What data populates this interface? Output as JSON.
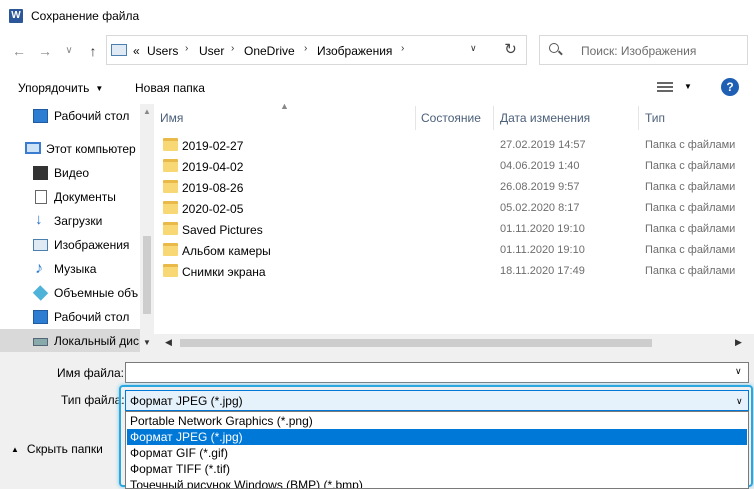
{
  "window": {
    "title": "Сохранение файла",
    "app_icon": "W"
  },
  "nav": {
    "back": "←",
    "forward": "→",
    "recent": "∨",
    "up": "↑"
  },
  "address": {
    "overflow": "«",
    "crumbs": [
      "Users",
      "User",
      "OneDrive",
      "Изображения"
    ],
    "refresh": "↻"
  },
  "search": {
    "placeholder": "Поиск: Изображения"
  },
  "toolbar": {
    "organize": "Упорядочить",
    "new_folder": "Новая папка",
    "help": "?"
  },
  "sidebar": {
    "items": [
      {
        "label": "Рабочий стол",
        "icon": "desktop-icon"
      },
      {
        "label": "Этот компьютер",
        "icon": "computer-icon"
      },
      {
        "label": "Видео",
        "icon": "video-icon"
      },
      {
        "label": "Документы",
        "icon": "documents-icon"
      },
      {
        "label": "Загрузки",
        "icon": "downloads-icon"
      },
      {
        "label": "Изображения",
        "icon": "pictures-icon"
      },
      {
        "label": "Музыка",
        "icon": "music-icon"
      },
      {
        "label": "Объемные объ",
        "icon": "3d-objects-icon"
      },
      {
        "label": "Рабочий стол",
        "icon": "desktop-icon"
      },
      {
        "label": "Локальный дис",
        "icon": "disk-icon"
      }
    ]
  },
  "columns": {
    "name": "Имя",
    "status": "Состояние",
    "date": "Дата изменения",
    "type": "Тип"
  },
  "files": [
    {
      "name": "2019-02-27",
      "date": "27.02.2019 14:57",
      "type": "Папка с файлами"
    },
    {
      "name": "2019-04-02",
      "date": "04.06.2019 1:40",
      "type": "Папка с файлами"
    },
    {
      "name": "2019-08-26",
      "date": "26.08.2019 9:57",
      "type": "Папка с файлами"
    },
    {
      "name": "2020-02-05",
      "date": "05.02.2020 8:17",
      "type": "Папка с файлами"
    },
    {
      "name": "Saved Pictures",
      "date": "01.11.2020 19:10",
      "type": "Папка с файлами"
    },
    {
      "name": "Альбом камеры",
      "date": "01.11.2020 19:10",
      "type": "Папка с файлами"
    },
    {
      "name": "Снимки экрана",
      "date": "18.11.2020 17:49",
      "type": "Папка с файлами"
    }
  ],
  "form": {
    "filename_label": "Имя файла:",
    "filename_value": "",
    "filetype_label": "Тип файла:",
    "filetype_value": "Формат JPEG (*.jpg)",
    "options": [
      "Portable Network Graphics (*.png)",
      "Формат JPEG (*.jpg)",
      "Формат GIF (*.gif)",
      "Формат TIFF (*.tif)",
      "Точечный рисунок Windows (BMP) (*.bmp)"
    ],
    "selected_option": "Формат JPEG (*.jpg)"
  },
  "footer": {
    "hide_folders": "Скрыть папки"
  },
  "colors": {
    "accent": "#0078d7",
    "highlight_border": "#2aa7df",
    "folder": "#f8d775"
  }
}
